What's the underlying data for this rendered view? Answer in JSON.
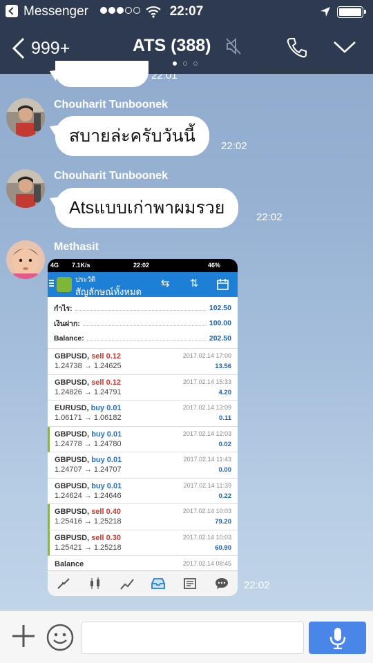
{
  "status_bar": {
    "back_app": "Messenger",
    "time": "22:07"
  },
  "header": {
    "back_count": "999+",
    "title": "ATS (388)"
  },
  "messages": [
    {
      "sender": "Chouharit Tunboonek",
      "text": "สบายล่ะครับวันนี้",
      "time": "22:02"
    },
    {
      "sender": "Chouharit Tunboonek",
      "text": "Atsแบบเก่าพาผมรวย",
      "time": "22:02"
    },
    {
      "sender": "Methasit",
      "time": "22:02"
    }
  ],
  "partial_time_top": "22:01",
  "shared_screenshot": {
    "status": {
      "network": "4G",
      "speed": "7.1K/s",
      "time": "22:02",
      "battery": "46%"
    },
    "header_small": "ประวัติ",
    "header_title": "สัญลักษณ์ทั้งหมด",
    "summary": [
      {
        "label": "กำไร:",
        "value": "102.50"
      },
      {
        "label": "เงินฝาก:",
        "value": "100.00"
      },
      {
        "label": "Balance:",
        "value": "202.50"
      }
    ],
    "trades": [
      {
        "symbol": "GBPUSD,",
        "type": "sell 0.12",
        "prices": "1.24738 → 1.24625",
        "date": "2017.02.14 17:00",
        "profit": "13.56",
        "mark": false,
        "color": "#d0342c"
      },
      {
        "symbol": "GBPUSD,",
        "type": "sell 0.12",
        "prices": "1.24826 → 1.24791",
        "date": "2017.02.14 15:33",
        "profit": "4.20",
        "mark": false,
        "color": "#d0342c"
      },
      {
        "symbol": "EURUSD,",
        "type": "buy 0.01",
        "prices": "1.06171 → 1.06182",
        "date": "2017.02.14 13:09",
        "profit": "0.11",
        "mark": false,
        "color": "#1e6fd0"
      },
      {
        "symbol": "GBPUSD,",
        "type": "buy 0.01",
        "prices": "1.24778 → 1.24780",
        "date": "2017.02.14 12:03",
        "profit": "0.02",
        "mark": true,
        "color": "#1e6fd0"
      },
      {
        "symbol": "GBPUSD,",
        "type": "buy 0.01",
        "prices": "1.24707 → 1.24707",
        "date": "2017.02.14 11:43",
        "profit": "0.00",
        "mark": false,
        "color": "#1e6fd0"
      },
      {
        "symbol": "GBPUSD,",
        "type": "buy 0.01",
        "prices": "1.24624 → 1.24646",
        "date": "2017.02.14 11:39",
        "profit": "0.22",
        "mark": false,
        "color": "#1e6fd0"
      },
      {
        "symbol": "GBPUSD,",
        "type": "sell 0.40",
        "prices": "1.25416 → 1.25218",
        "date": "2017.02.14 10:03",
        "profit": "79.20",
        "mark": true,
        "color": "#d0342c"
      },
      {
        "symbol": "GBPUSD,",
        "type": "sell 0.30",
        "prices": "1.25421 → 1.25218",
        "date": "2017.02.14 10:03",
        "profit": "60.90",
        "mark": true,
        "color": "#d0342c"
      }
    ],
    "balance_row": {
      "label": "Balance",
      "date": "2017.02.14 08:45"
    }
  },
  "colors": {
    "header_bg": "#2e3a4f",
    "mic_button": "#4a86e8",
    "app_blue": "#1e7fd6"
  }
}
